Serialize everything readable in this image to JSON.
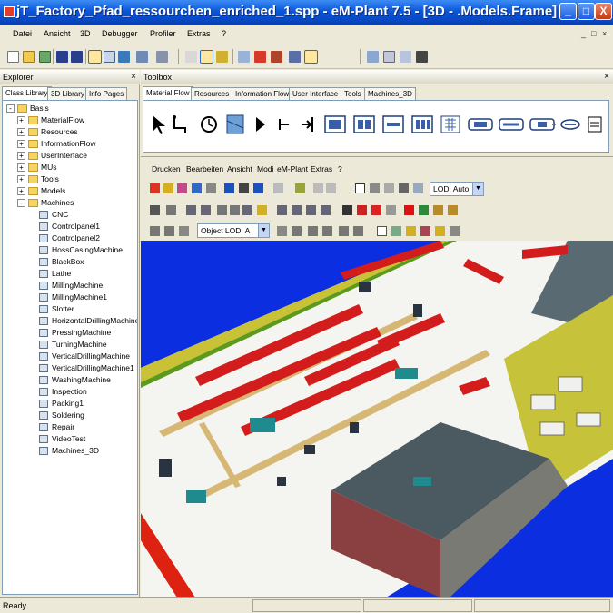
{
  "window": {
    "title": "jT_Factory_Pfad_ressourchen_enriched_1.spp - eM-Plant 7.5 - [3D - .Models.Frame]",
    "controls": {
      "minimize": "_",
      "maximize": "□",
      "close": "X"
    }
  },
  "menu": {
    "items": [
      "Datei",
      "Ansicht",
      "3D",
      "Debugger",
      "Profiler",
      "Extras",
      "?"
    ],
    "mdi_controls": [
      "_",
      "□",
      "×"
    ]
  },
  "explorer": {
    "title": "Explorer",
    "close": "×",
    "tabs": [
      "Class Library",
      "3D Library",
      "Info Pages"
    ],
    "active_tab": "Class Library",
    "tree": [
      {
        "label": "Basis",
        "level": 0,
        "expander": "-",
        "type": "root"
      },
      {
        "label": "MaterialFlow",
        "level": 1,
        "expander": "+",
        "type": "folder"
      },
      {
        "label": "Resources",
        "level": 1,
        "expander": "+",
        "type": "folder"
      },
      {
        "label": "InformationFlow",
        "level": 1,
        "expander": "+",
        "type": "folder"
      },
      {
        "label": "UserInterface",
        "level": 1,
        "expander": "+",
        "type": "folder"
      },
      {
        "label": "MUs",
        "level": 1,
        "expander": "+",
        "type": "folder"
      },
      {
        "label": "Tools",
        "level": 1,
        "expander": "+",
        "type": "folder"
      },
      {
        "label": "Models",
        "level": 1,
        "expander": "+",
        "type": "folder"
      },
      {
        "label": "Machines",
        "level": 1,
        "expander": "-",
        "type": "folder"
      },
      {
        "label": "CNC",
        "level": 2,
        "expander": "",
        "type": "leaf"
      },
      {
        "label": "Controlpanel1",
        "level": 2,
        "expander": "",
        "type": "leaf"
      },
      {
        "label": "Controlpanel2",
        "level": 2,
        "expander": "",
        "type": "leaf"
      },
      {
        "label": "HossCasingMachine",
        "level": 2,
        "expander": "",
        "type": "leaf"
      },
      {
        "label": "BlackBox",
        "level": 2,
        "expander": "",
        "type": "leaf"
      },
      {
        "label": "Lathe",
        "level": 2,
        "expander": "",
        "type": "leaf"
      },
      {
        "label": "MillingMachine",
        "level": 2,
        "expander": "",
        "type": "leaf"
      },
      {
        "label": "MillingMachine1",
        "level": 2,
        "expander": "",
        "type": "leaf"
      },
      {
        "label": "Slotter",
        "level": 2,
        "expander": "",
        "type": "leaf"
      },
      {
        "label": "HorizontalDrillingMachine",
        "level": 2,
        "expander": "",
        "type": "leaf"
      },
      {
        "label": "PressingMachine",
        "level": 2,
        "expander": "",
        "type": "leaf"
      },
      {
        "label": "TurningMachine",
        "level": 2,
        "expander": "",
        "type": "leaf"
      },
      {
        "label": "VerticalDrillingMachine",
        "level": 2,
        "expander": "",
        "type": "leaf"
      },
      {
        "label": "VerticalDrillingMachine1",
        "level": 2,
        "expander": "",
        "type": "leaf"
      },
      {
        "label": "WashingMachine",
        "level": 2,
        "expander": "",
        "type": "leaf"
      },
      {
        "label": "Inspection",
        "level": 2,
        "expander": "",
        "type": "leaf"
      },
      {
        "label": "Packing1",
        "level": 2,
        "expander": "",
        "type": "leaf"
      },
      {
        "label": "Soldering",
        "level": 2,
        "expander": "",
        "type": "leaf"
      },
      {
        "label": "Repair",
        "level": 2,
        "expander": "",
        "type": "leaf"
      },
      {
        "label": "VideoTest",
        "level": 2,
        "expander": "",
        "type": "leaf"
      },
      {
        "label": "Machines_3D",
        "level": 2,
        "expander": "",
        "type": "leaf"
      }
    ]
  },
  "toolbox": {
    "title": "Toolbox",
    "close": "×",
    "tabs": [
      "Material Flow",
      "Resources",
      "Information Flow",
      "User Interface",
      "Tools",
      "Machines_3D"
    ],
    "active_tab": "Material Flow"
  },
  "frame": {
    "menu": [
      "Drucken",
      "Bearbeiten",
      "Ansicht",
      "Modi",
      "eM-Plant",
      "Extras",
      "?"
    ],
    "lod_label": "LOD: Auto",
    "object_lod_label": "Object LOD: A"
  },
  "status": {
    "text": "Ready"
  }
}
